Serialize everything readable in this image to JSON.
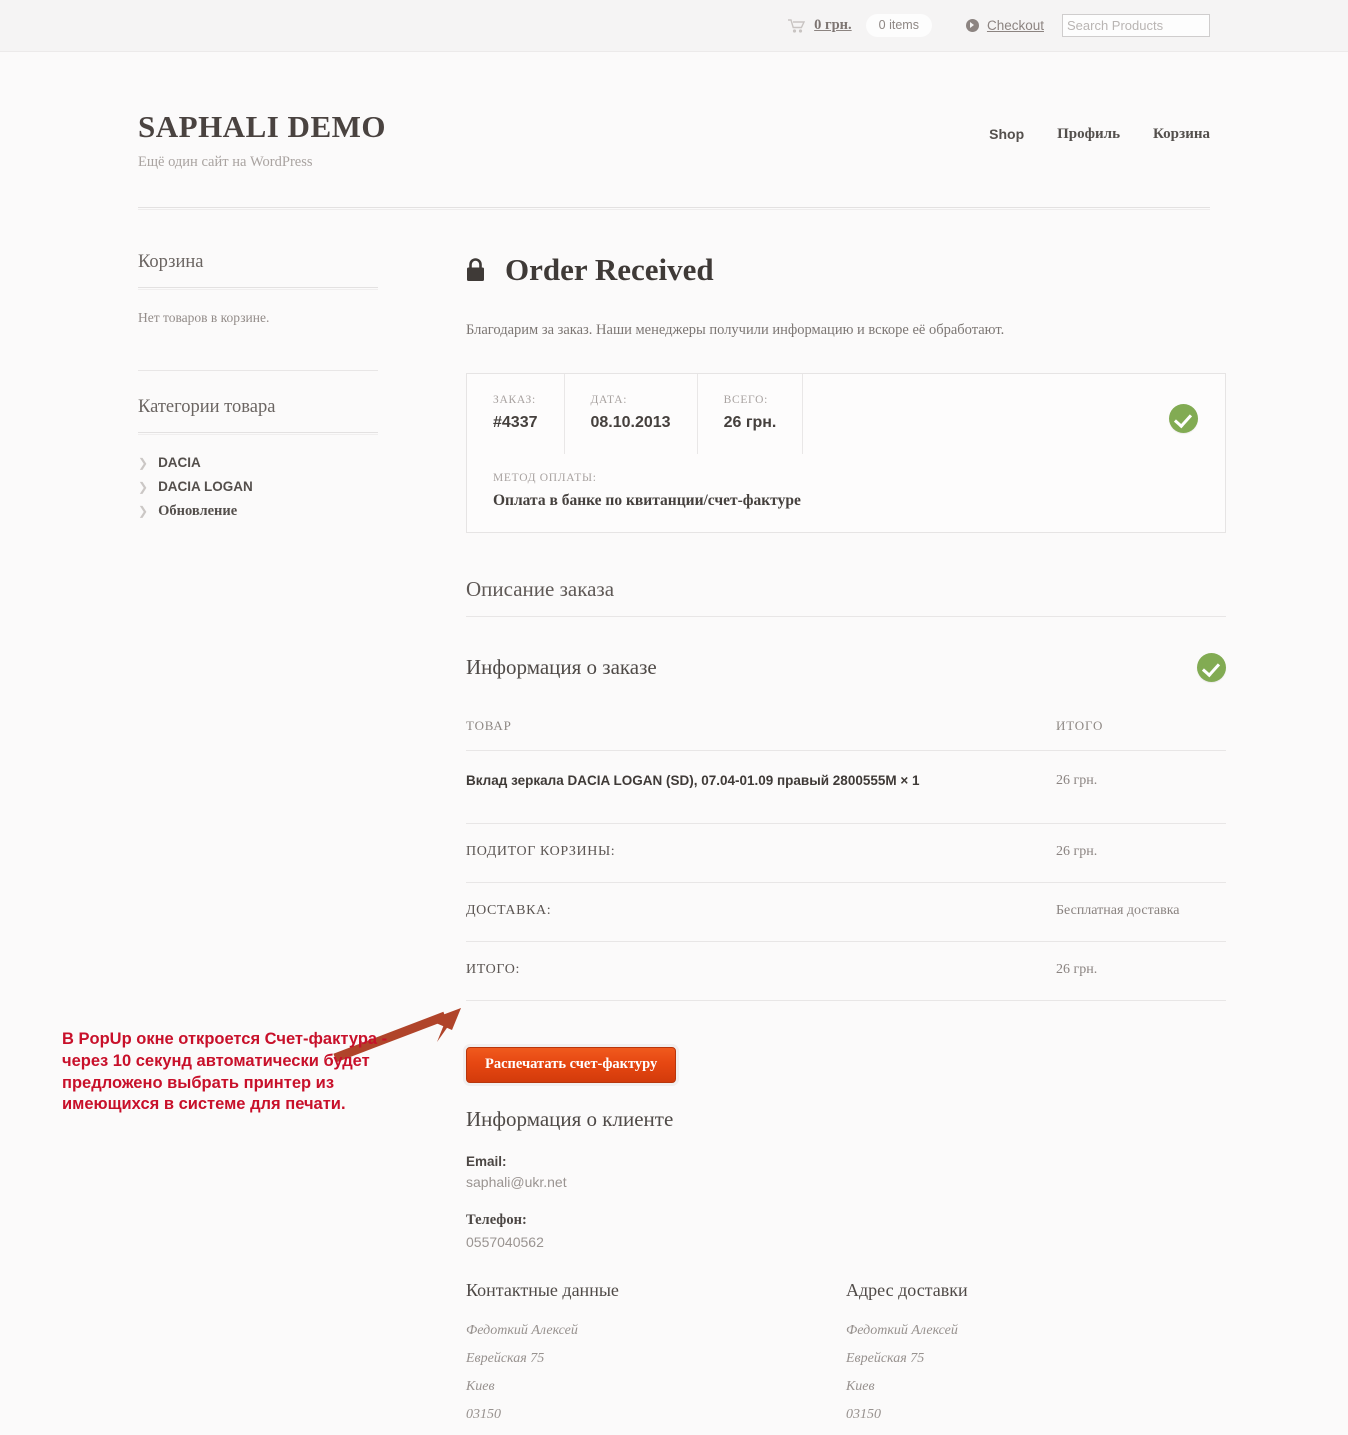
{
  "topbar": {
    "cart_icon": "shopping-cart-icon",
    "cart_amount": "0 грн.",
    "items_count": "0 items",
    "checkout_icon": "play-circle-icon",
    "checkout_label": "Checkout",
    "search_placeholder": "Search Products",
    "search_value": ""
  },
  "header": {
    "site_title": "SAPHALI DEMO",
    "site_description": "Ещё один сайт на WordPress",
    "nav": [
      {
        "label": "Shop",
        "lang": "en"
      },
      {
        "label": "Профиль",
        "lang": "ru"
      },
      {
        "label": "Корзина",
        "lang": "ru"
      }
    ]
  },
  "sidebar": {
    "cart_widget": {
      "title": "Корзина",
      "empty_text": "Нет товаров в корзине."
    },
    "categories_widget": {
      "title": "Категории товара",
      "items": [
        {
          "label": "DACIA",
          "lang": "en"
        },
        {
          "label": "DACIA LOGAN",
          "lang": "en"
        },
        {
          "label": "Обновление",
          "lang": "ru"
        }
      ]
    }
  },
  "main": {
    "lock_icon": "lock-icon",
    "page_title": "Order Received",
    "intro": "Благодарим за заказ. Наши менеджеры получили информацию и вскоре её обработают.",
    "order_box": {
      "order_label": "ЗАКАЗ:",
      "order_value": "#4337",
      "date_label": "ДАТА:",
      "date_value": "08.10.2013",
      "total_label": "ВСЕГО:",
      "total_value": "26 грн.",
      "payment_label": "МЕТОД ОПЛАТЫ:",
      "payment_value": "Оплата в банке по квитанции/счет-фактуре",
      "status_icon": "green-check-icon"
    },
    "order_description_title": "Описание заказа",
    "order_info_title": "Информация о заказе",
    "order_info_status_icon": "green-check-icon",
    "table": {
      "col_product": "ТОВАР",
      "col_total": "ИТОГО",
      "rows": [
        {
          "name": "Вклад зеркала DACIA LOGAN (SD), 07.04-01.09 правый 2800555M × 1",
          "amount": "26 грн."
        }
      ],
      "footer": [
        {
          "label": "ПОДИТОГ КОРЗИНЫ:",
          "value": "26 грн."
        },
        {
          "label": "ДОСТАВКА:",
          "value": "Бесплатная доставка"
        },
        {
          "label": "ИТОГО:",
          "value": "26 грн."
        }
      ]
    },
    "print_invoice_button": "Распечатать счет-фактуру",
    "client": {
      "title": "Информация о клиенте",
      "email_label": "Email:",
      "email_value": "saphali@ukr.net",
      "phone_label": "Телефон:",
      "phone_value": "0557040562"
    },
    "addresses": [
      {
        "title": "Контактные данные",
        "lines": [
          "Федоткий Алексей",
          "Еврейская 75",
          "Киев",
          "03150"
        ]
      },
      {
        "title": "Адрес доставки",
        "lines": [
          "Федоткий Алексей",
          "Еврейская 75",
          "Киев",
          "03150"
        ]
      }
    ]
  },
  "annotation": {
    "text": "В PopUp окне откроется Счет-фактура - через 10 секунд автоматически будет предложено выбрать принтер из имеющихся в системе для печати.",
    "color": "#c8102a",
    "arrow_color": "#b0442a",
    "arrow_icon": "arrow-pointer-icon"
  },
  "colors": {
    "topbar_bg": "#f5f4f4",
    "page_bg": "#fbfafa",
    "accent_button": "#e64712",
    "status_green": "#82ab53"
  }
}
